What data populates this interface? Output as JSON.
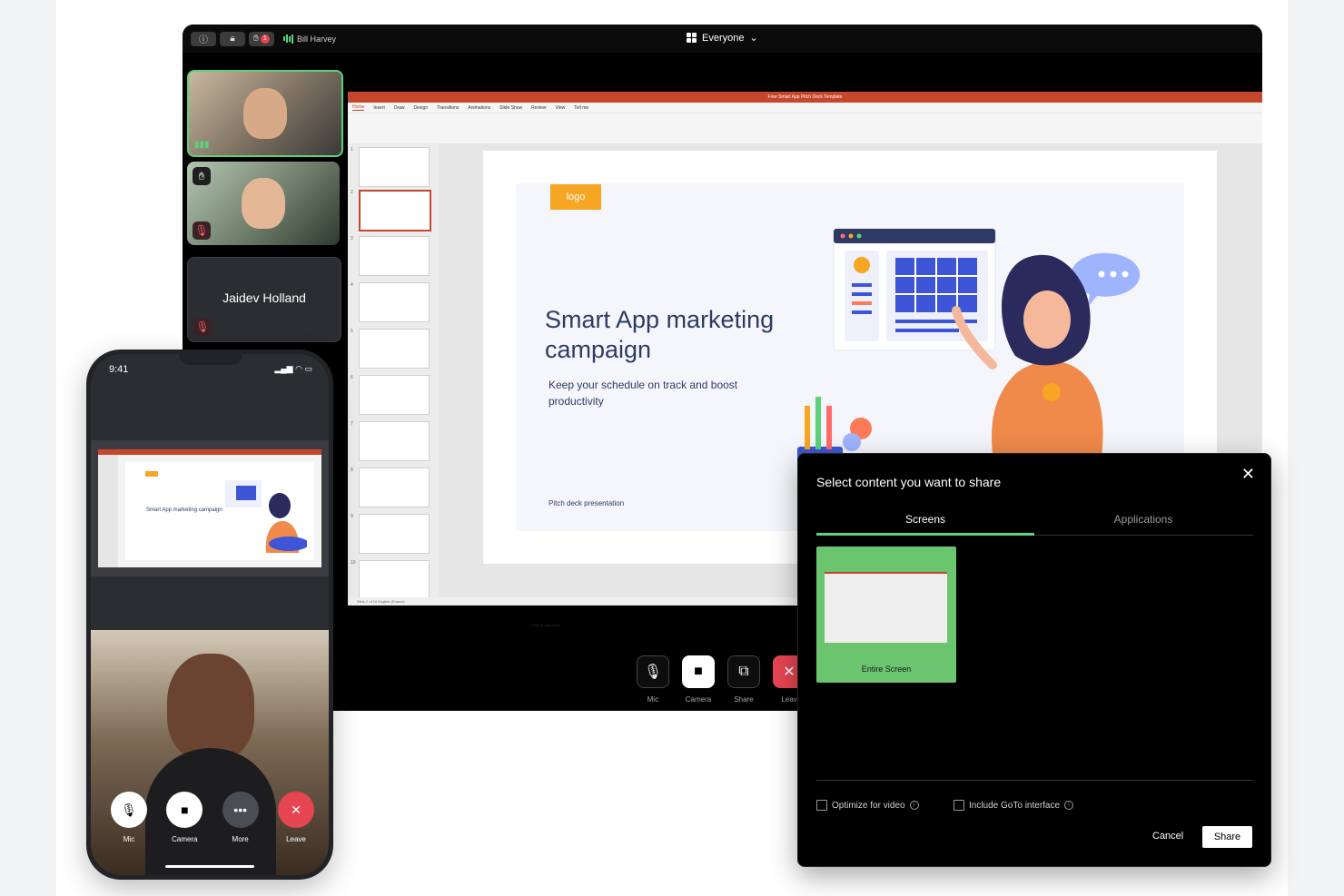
{
  "meeting": {
    "presenter_name": "Bill Harvey",
    "view_label": "Everyone",
    "notification_count": "1",
    "participants": [
      {
        "name": "",
        "state": "speaking"
      },
      {
        "name": "",
        "state": "hand-raised"
      },
      {
        "name": "Jaidev Holland",
        "state": "muted"
      }
    ],
    "controls": [
      {
        "label": "Mic",
        "icon": "mic-off-icon"
      },
      {
        "label": "Camera",
        "icon": "camera-icon"
      },
      {
        "label": "Share",
        "icon": "share-screen-icon"
      },
      {
        "label": "Leav",
        "icon": "close-icon"
      }
    ]
  },
  "powerpoint": {
    "window_title": "Free Smart App Pitch Deck Template",
    "tabs": [
      "Home",
      "Insert",
      "Draw",
      "Design",
      "Transitions",
      "Animations",
      "Slide Show",
      "Review",
      "View",
      "Tell me"
    ],
    "notes_placeholder": "Click to add notes",
    "status": "Slide 2 of 10   English (France)",
    "thumbnail_numbers": [
      "1",
      "2",
      "3",
      "4",
      "5",
      "6",
      "7",
      "8",
      "9",
      "10"
    ],
    "slide": {
      "logo_text": "logo",
      "title": "Smart App marketing campaign",
      "subtitle": "Keep your schedule on track and boost productivity",
      "footer": "Pitch deck presentation"
    }
  },
  "share_dialog": {
    "title": "Select content you want to share",
    "tabs": {
      "screens": "Screens",
      "applications": "Applications"
    },
    "screen_option_label": "Entire Screen",
    "options": {
      "optimize_video": "Optimize for video",
      "include_goto": "Include GoTo interface"
    },
    "cancel_label": "Cancel",
    "share_label": "Share"
  },
  "phone": {
    "time": "9:41",
    "slide_title": "Smart App marketing campaign",
    "controls": [
      {
        "label": "Mic",
        "icon": "mic-icon"
      },
      {
        "label": "Camera",
        "icon": "camera-icon"
      },
      {
        "label": "More",
        "icon": "more-icon"
      },
      {
        "label": "Leave",
        "icon": "close-icon"
      }
    ]
  },
  "colors": {
    "accent_green": "#5bd27b",
    "danger_red": "#e64552",
    "ppt_orange": "#c6462b",
    "logo_yellow": "#f6a623",
    "slide_text": "#2d3a63"
  }
}
